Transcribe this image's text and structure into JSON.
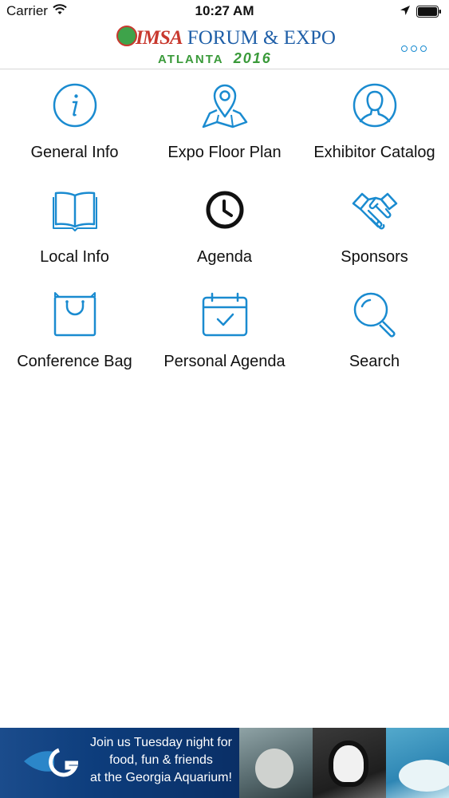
{
  "status_bar": {
    "carrier": "Carrier",
    "time": "10:27 AM"
  },
  "header": {
    "logo_imsa": "IMSA",
    "logo_forum_expo": "FORUM & EXPO",
    "logo_city": "ATLANTA",
    "logo_year": "2016"
  },
  "menu": [
    {
      "label": "General Info",
      "icon": "info-icon"
    },
    {
      "label": "Expo Floor Plan",
      "icon": "map-pin-icon"
    },
    {
      "label": "Exhibitor Catalog",
      "icon": "person-icon"
    },
    {
      "label": "Local Info",
      "icon": "book-icon"
    },
    {
      "label": "Agenda",
      "icon": "clock-icon"
    },
    {
      "label": "Sponsors",
      "icon": "handshake-icon"
    },
    {
      "label": "Conference Bag",
      "icon": "bag-icon"
    },
    {
      "label": "Personal Agenda",
      "icon": "calendar-check-icon"
    },
    {
      "label": "Search",
      "icon": "search-icon"
    }
  ],
  "banner": {
    "line1": "Join us Tuesday night for",
    "line2": "food, fun & friends",
    "line3": "at the Georgia Aquarium!"
  },
  "colors": {
    "accent": "#1a8bd0",
    "agenda_icon": "#111111",
    "banner_bg": "#0c3a78"
  }
}
